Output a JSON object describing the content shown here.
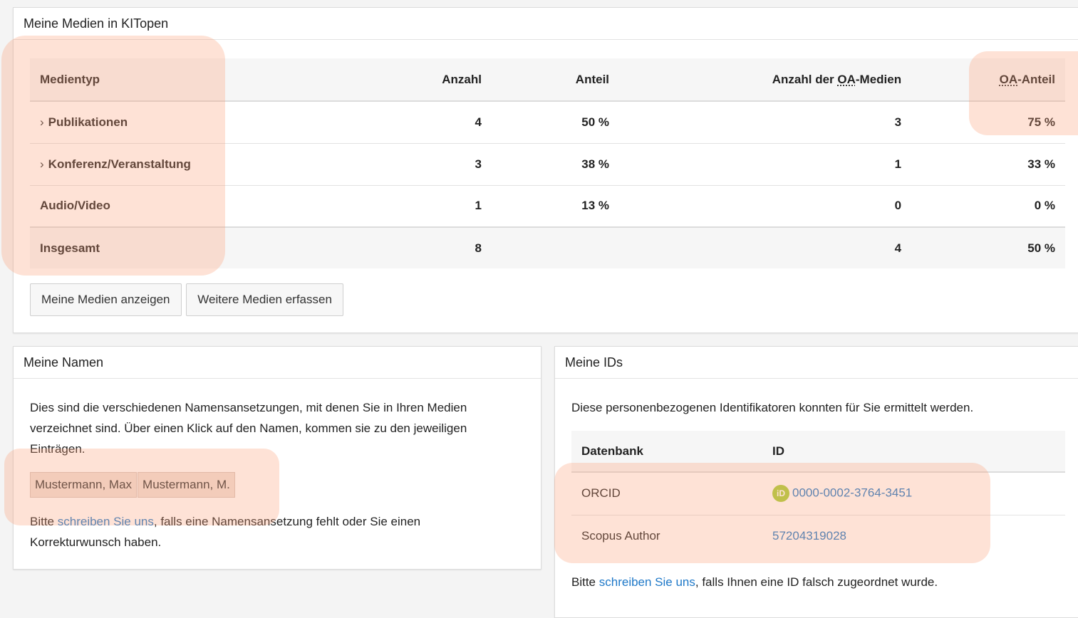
{
  "media_panel": {
    "title": "Meine Medien in KITopen",
    "headers": {
      "type": "Medientyp",
      "count": "Anzahl",
      "share": "Anteil",
      "oa_count_prefix": "Anzahl der ",
      "oa_abbr": "OA",
      "oa_count_suffix": "-Medien",
      "oa_share_abbr": "OA",
      "oa_share_suffix": "-Anteil"
    },
    "rows": [
      {
        "chevron": "›",
        "type": "Publikationen",
        "count": "4",
        "share": "50 %",
        "oa_count": "3",
        "oa_share": "75 %"
      },
      {
        "chevron": "›",
        "type": "Konferenz/Veranstaltung",
        "count": "3",
        "share": "38 %",
        "oa_count": "1",
        "oa_share": "33 %"
      },
      {
        "chevron": "",
        "type": "Audio/Video",
        "count": "1",
        "share": "13 %",
        "oa_count": "0",
        "oa_share": "0 %"
      }
    ],
    "total": {
      "type": "Insgesamt",
      "count": "8",
      "share": "",
      "oa_count": "4",
      "oa_share": "50 %"
    },
    "buttons": {
      "show": "Meine Medien anzeigen",
      "add": "Weitere Medien erfassen"
    }
  },
  "names_panel": {
    "title": "Meine Namen",
    "intro_line1": "Dies sind die verschiedenen Namensansetzungen, mit denen Sie in Ihren Medien",
    "intro_line2": "verzeichnet sind. Über einen Klick auf den Namen, kommen sie zu den jeweiligen",
    "intro_line3": "Einträgen.",
    "names": [
      "Mustermann, Max",
      "Mustermann, M."
    ],
    "footer_prefix": "Bitte ",
    "footer_link": "schreiben Sie uns",
    "footer_suffix_line1": ", falls eine Namensansetzung fehlt oder Sie einen",
    "footer_line2": "Korrekturwunsch haben."
  },
  "ids_panel": {
    "title": "Meine IDs",
    "intro": "Diese personenbezogenen Identifikatoren konnten für Sie ermittelt werden.",
    "headers": {
      "db": "Datenbank",
      "id": "ID"
    },
    "rows": [
      {
        "db": "ORCID",
        "id": "0000-0002-3764-3451",
        "icon": "orcid-icon",
        "icon_text": "iD"
      },
      {
        "db": "Scopus Author",
        "id": "57204319028"
      }
    ],
    "footer_prefix": "Bitte ",
    "footer_link": "schreiben Sie uns",
    "footer_suffix": ", falls Ihnen eine ID falsch zugeordnet wurde."
  },
  "colors": {
    "link": "#1e78c8",
    "highlight": "#fca078",
    "orcid": "#a6ce39"
  }
}
